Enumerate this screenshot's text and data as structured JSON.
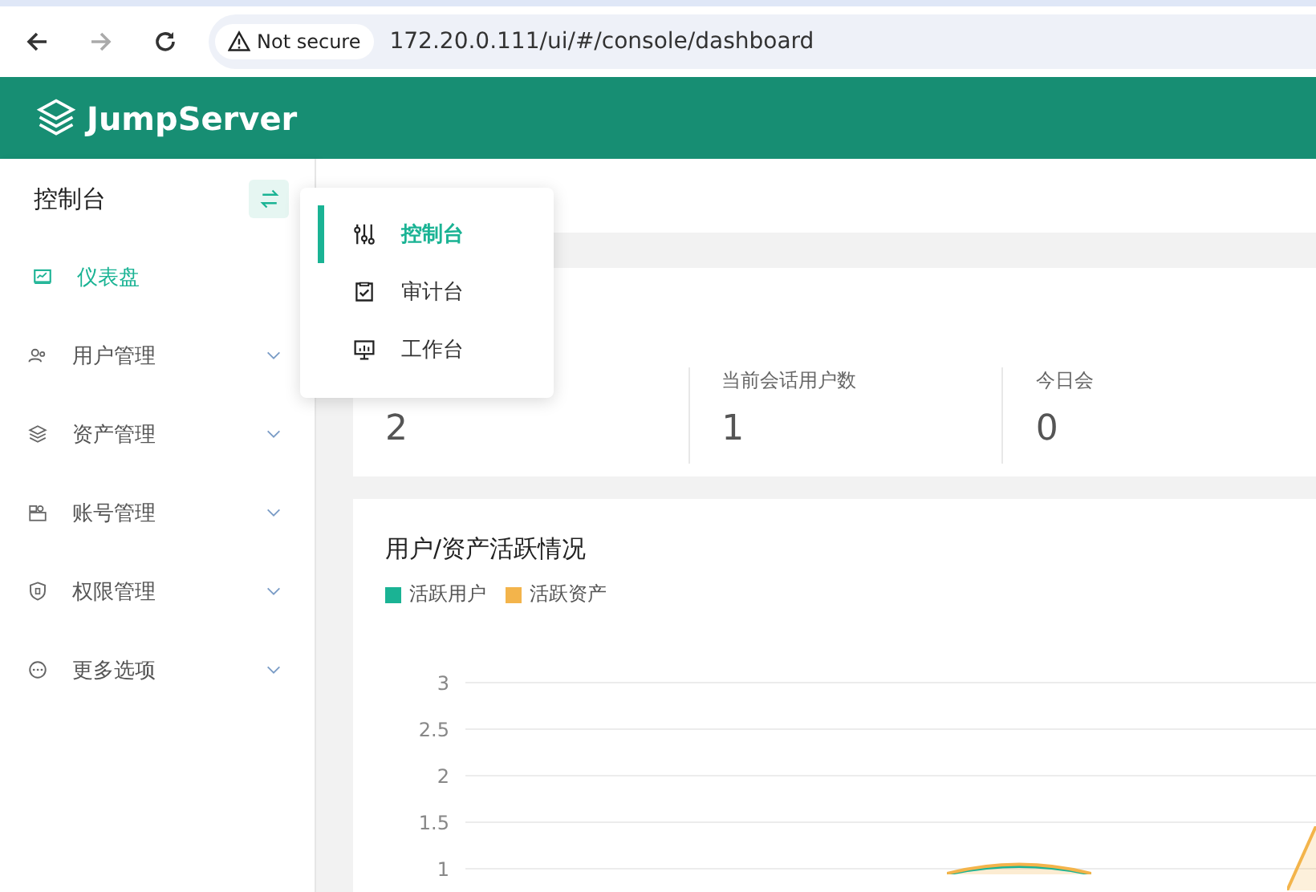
{
  "browser": {
    "forward_disabled": true,
    "security_badge": "Not secure",
    "url": "172.20.0.111/ui/#/console/dashboard"
  },
  "header": {
    "logo_text": "JumpServer"
  },
  "sidebar": {
    "title": "控制台",
    "items": [
      {
        "label": "仪表盘",
        "selected": true,
        "has_submenu": false
      },
      {
        "label": "用户管理",
        "selected": false,
        "has_submenu": true
      },
      {
        "label": "资产管理",
        "selected": false,
        "has_submenu": true
      },
      {
        "label": "账号管理",
        "selected": false,
        "has_submenu": true
      },
      {
        "label": "权限管理",
        "selected": false,
        "has_submenu": true
      },
      {
        "label": "更多选项",
        "selected": false,
        "has_submenu": true
      }
    ]
  },
  "view_menu": {
    "items": [
      {
        "label": "控制台",
        "selected": true
      },
      {
        "label": "审计台",
        "selected": false
      },
      {
        "label": "工作台",
        "selected": false
      }
    ]
  },
  "stats": [
    {
      "value": "2"
    },
    {
      "label": "当前会话用户数",
      "value": "1"
    },
    {
      "label": "今日会",
      "value": "0"
    }
  ],
  "chart_card": {
    "title": "用户/资产活跃情况",
    "legend": [
      {
        "label": "活跃用户",
        "color": "#1ab394"
      },
      {
        "label": "活跃资产",
        "color": "#f3b44b"
      }
    ],
    "y_ticks": [
      "3",
      "2.5",
      "2",
      "1.5",
      "1"
    ]
  }
}
